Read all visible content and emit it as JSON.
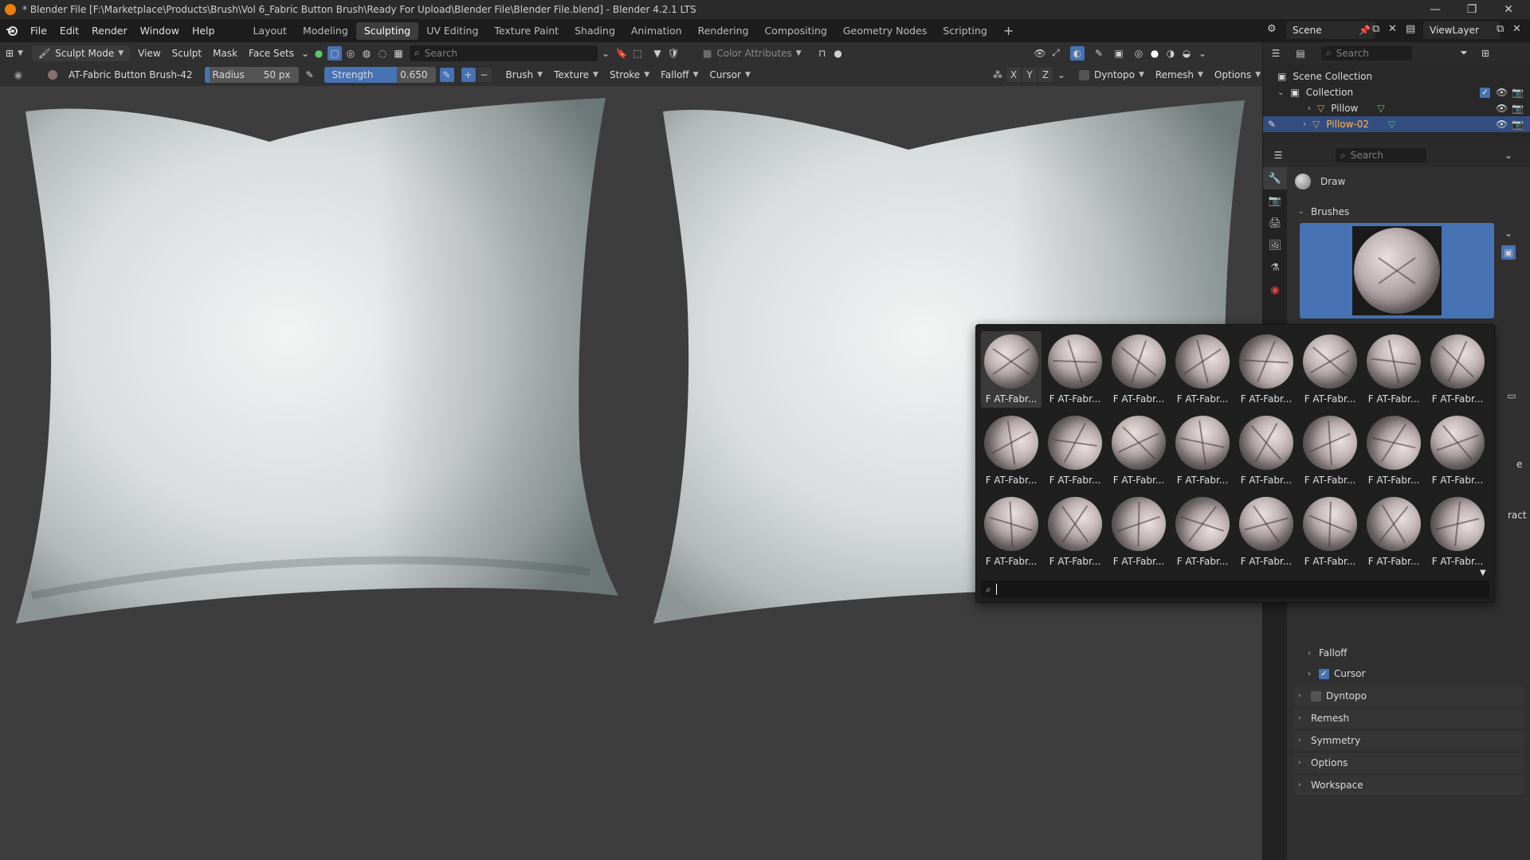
{
  "window": {
    "title": "* Blender File [F:\\Marketplace\\Products\\Brush\\Vol 6_Fabric Button Brush\\Ready For Upload\\Blender File\\Blender File.blend] - Blender 4.2.1 LTS",
    "minimize": "—",
    "maximize": "❐",
    "close": "✕"
  },
  "menus": [
    "File",
    "Edit",
    "Render",
    "Window",
    "Help"
  ],
  "workspaces": [
    "Layout",
    "Modeling",
    "Sculpting",
    "UV Editing",
    "Texture Paint",
    "Shading",
    "Animation",
    "Rendering",
    "Compositing",
    "Geometry Nodes",
    "Scripting"
  ],
  "active_workspace": "Sculpting",
  "scene": {
    "name": "Scene",
    "view_layer": "ViewLayer"
  },
  "header1": {
    "mode": "Sculpt Mode",
    "menus": [
      "View",
      "Sculpt",
      "Mask",
      "Face Sets"
    ],
    "search_placeholder": "Search",
    "color_attributes": "Color Attributes"
  },
  "header2": {
    "brush_name": "AT-Fabric Button Brush-42",
    "radius_label": "Radius",
    "radius_value": "50 px",
    "strength_label": "Strength",
    "strength_value": "0.650",
    "strength_fraction": 0.65,
    "dropdowns": [
      "Brush",
      "Texture",
      "Stroke",
      "Falloff",
      "Cursor"
    ],
    "axes": [
      "X",
      "Y",
      "Z"
    ],
    "right_dropdowns": [
      "Dyntopo",
      "Remesh",
      "Options"
    ]
  },
  "outliner": {
    "search_placeholder": "Search",
    "scene_collection": "Scene Collection",
    "collection": "Collection",
    "objects": [
      "Pillow",
      "Pillow-02"
    ],
    "selected_object": "Pillow-02"
  },
  "properties": {
    "search_placeholder": "Search",
    "tool_name": "Draw",
    "brushes_panel": "Brushes",
    "partial_label": "ract",
    "partial_label_2": "e",
    "sub_panels": [
      {
        "label": "Falloff",
        "checkbox": null
      },
      {
        "label": "Cursor",
        "checkbox": true
      }
    ],
    "panels": [
      {
        "label": "Dyntopo",
        "checkbox": false
      },
      {
        "label": "Remesh",
        "checkbox": null
      },
      {
        "label": "Symmetry",
        "checkbox": null
      },
      {
        "label": "Options",
        "checkbox": null
      },
      {
        "label": "Workspace",
        "checkbox": null
      }
    ]
  },
  "brush_popup": {
    "items": [
      "F AT-Fabr...",
      "F AT-Fabr...",
      "F AT-Fabr...",
      "F AT-Fabr...",
      "F AT-Fabr...",
      "F AT-Fabr...",
      "F AT-Fabr...",
      "F AT-Fabr...",
      "F AT-Fabr...",
      "F AT-Fabr...",
      "F AT-Fabr...",
      "F AT-Fabr...",
      "F AT-Fabr...",
      "F AT-Fabr...",
      "F AT-Fabr...",
      "F AT-Fabr...",
      "F AT-Fabr...",
      "F AT-Fabr...",
      "F AT-Fabr...",
      "F AT-Fabr...",
      "F AT-Fabr...",
      "F AT-Fabr...",
      "F AT-Fabr...",
      "F AT-Fabr..."
    ],
    "selected_index": 0,
    "search_value": ""
  },
  "colors": {
    "accent": "#4772b3",
    "selection": "#334d80",
    "blender_orange": "#e87d0d",
    "outliner_object_selected": "#ffb54d",
    "mesh_icon": "#e09447",
    "mesh_data_icon": "#5fc96b"
  },
  "icons": {
    "blender-logo": "blender-logo-icon",
    "search": "search-icon",
    "eye": "eye-icon",
    "camera": "camera-icon",
    "filter": "filter-icon",
    "chevron-down": "chevron-down-icon",
    "chevron-right": "chevron-right-icon"
  }
}
